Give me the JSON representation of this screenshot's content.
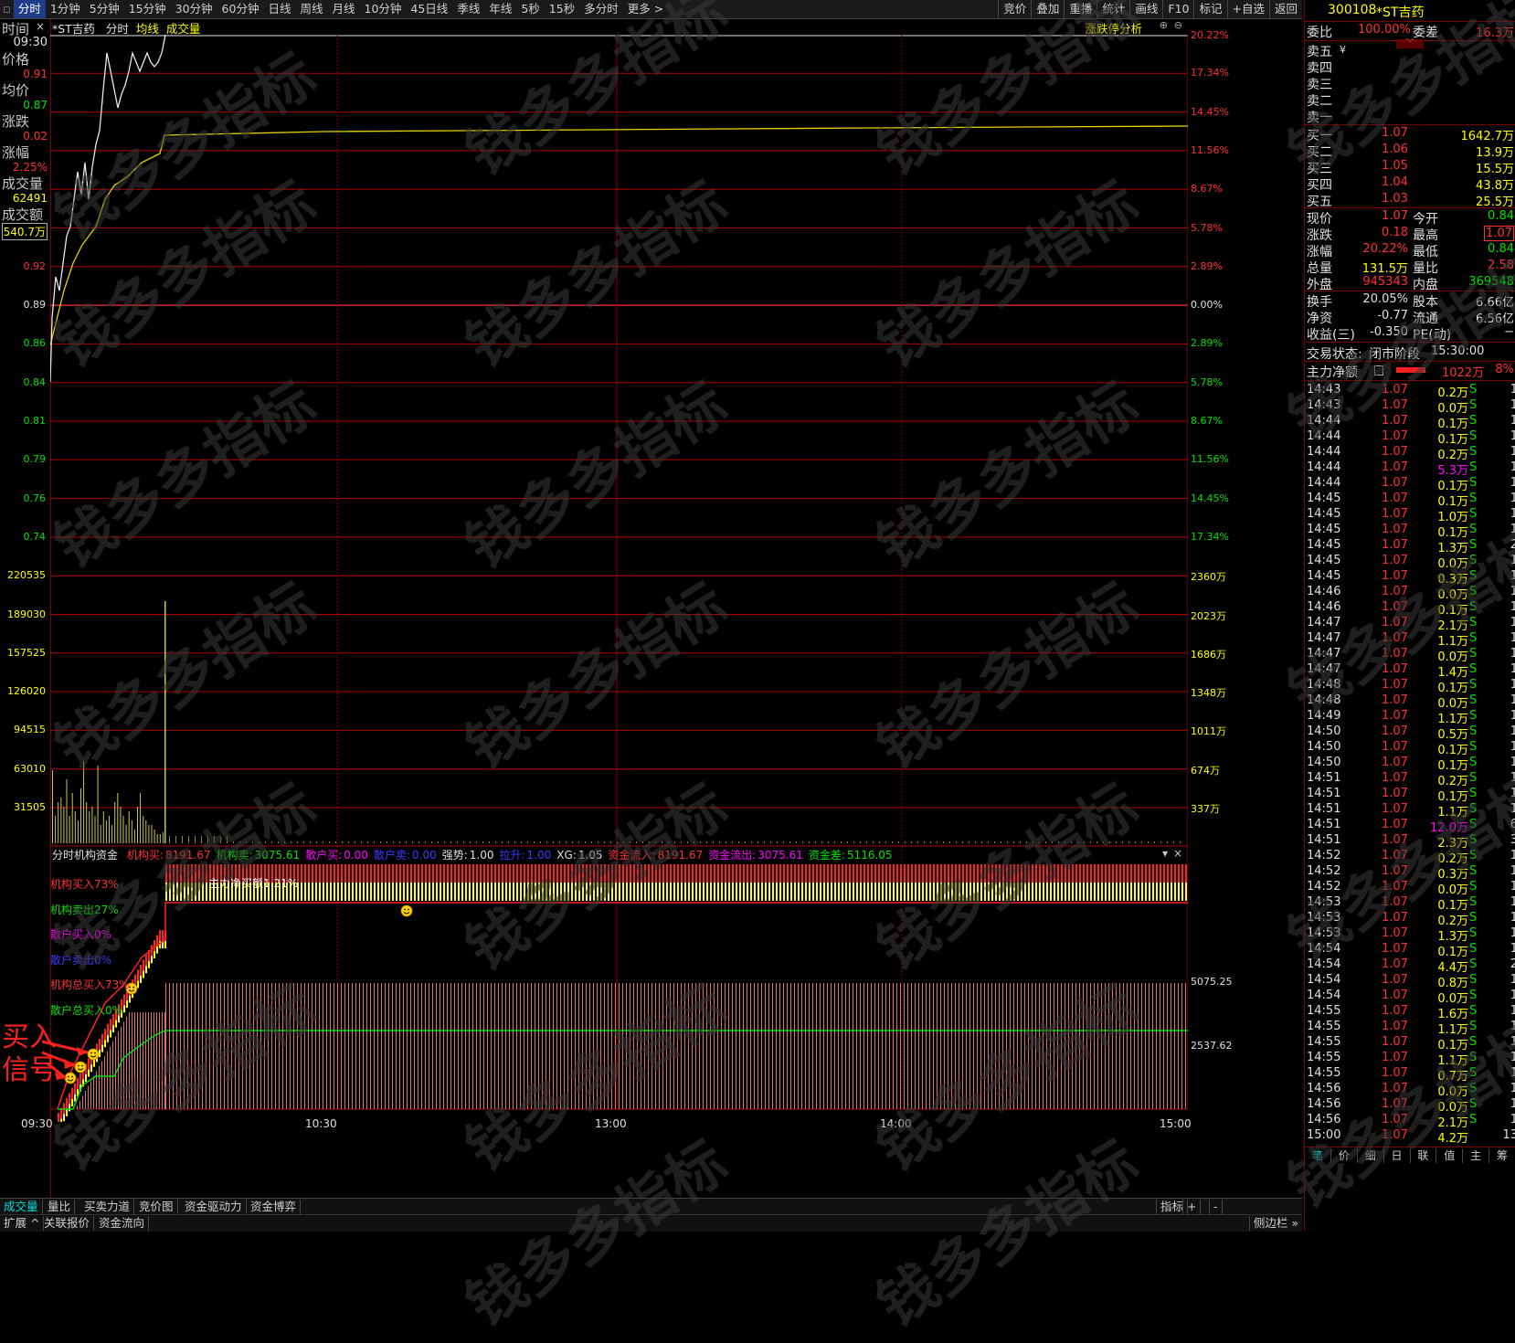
{
  "toolbar": {
    "tabs": [
      "分时",
      "1分钟",
      "5分钟",
      "15分钟",
      "30分钟",
      "60分钟",
      "日线",
      "周线",
      "月线",
      "10分钟",
      "45日线",
      "季线",
      "年线",
      "5秒",
      "15秒",
      "多分时",
      "更多 >"
    ],
    "right": [
      "竞价",
      "叠加",
      "重播",
      "统计",
      "画线",
      "F10",
      "标记",
      "+自选",
      "返回"
    ]
  },
  "chart_header": {
    "stock": "*ST吉药",
    "mode": "分时",
    "avg": "均线",
    "vol": "成交量",
    "analysis": "涨跌停分析"
  },
  "left_info": {
    "time_label": "时间",
    "time_value": "09:30",
    "price_label": "价格",
    "price_value": "0.91",
    "avg_label": "均价",
    "avg_value": "0.87",
    "change_label": "涨跌",
    "change_value": "0.02",
    "pct_label": "涨幅",
    "pct_value": "2.25%",
    "vol_label": "成交量",
    "vol_value": "62491",
    "amt_label": "成交额",
    "amt_value": "540.7万"
  },
  "price_axis_left": [
    "0.92",
    "0.89",
    "0.86",
    "0.84",
    "0.81",
    "0.79",
    "0.76",
    "0.74"
  ],
  "price_axis_right": [
    "20.22%",
    "17.34%",
    "14.45%",
    "11.56%",
    "8.67%",
    "5.78%",
    "2.89%",
    "0.00%",
    "2.89%",
    "5.78%",
    "8.67%",
    "11.56%",
    "14.45%",
    "17.34%"
  ],
  "volume_axis_left": [
    "220535",
    "189030",
    "157525",
    "126020",
    "94515",
    "63010",
    "31505"
  ],
  "volume_axis_right": [
    "2360万",
    "2023万",
    "1686万",
    "1348万",
    "1011万",
    "674万",
    "337万"
  ],
  "indicator": {
    "name": "分时机构资金",
    "items": [
      {
        "label": "机构买:",
        "value": "8191.67",
        "color": "#ff3030"
      },
      {
        "label": "机构卖:",
        "value": "3075.61",
        "color": "#00e000"
      },
      {
        "label": "散户买:",
        "value": "0.00",
        "color": "#ff00ff"
      },
      {
        "label": "散户卖:",
        "value": "0.00",
        "color": "#3a3aff"
      },
      {
        "label": "强势:",
        "value": "1.00",
        "color": "#e0e0e0"
      },
      {
        "label": "拉升:",
        "value": "1.00",
        "color": "#3a3aff"
      },
      {
        "label": "XG:",
        "value": "1.05",
        "color": "#e0e0e0"
      },
      {
        "label": "资金流入:",
        "value": "8191.67",
        "color": "#ff3030"
      },
      {
        "label": "资金流出:",
        "value": "3075.61",
        "color": "#ff00ff"
      },
      {
        "label": "资金差:",
        "value": "5116.05",
        "color": "#00e000"
      }
    ],
    "legend": [
      {
        "text": "机构买入73%",
        "color": "#ff3030"
      },
      {
        "text": "机构卖出27%",
        "color": "#00e000"
      },
      {
        "text": "散户买入0%",
        "color": "#ff00ff"
      },
      {
        "text": "散户卖出0%",
        "color": "#3a3aff"
      },
      {
        "text": "机构总买入73%",
        "color": "#ff3030"
      },
      {
        "text": "散户总买入0%",
        "color": "#00e000"
      }
    ],
    "banner": "主力净买额1.21%",
    "right_ticks": [
      "5075.25",
      "2537.62"
    ],
    "signal": "买入信号"
  },
  "time_axis": [
    "09:30",
    "10:30",
    "13:00",
    "14:00",
    "15:00"
  ],
  "bottom_tabs_1": [
    "成交量",
    "量比",
    "买卖力道",
    "竞价图",
    "资金驱动力",
    "资金博弈"
  ],
  "bottom_right_1": [
    "指标",
    "+",
    "-"
  ],
  "bottom_tabs_2": [
    "扩展 ^",
    "关联报价",
    "资金流向"
  ],
  "bottom_right_2": "侧边栏 »",
  "panel": {
    "code": "300108",
    "name": "*ST吉药",
    "weibi_label": "委比",
    "weibi": "100.00%",
    "weicha_label": "委差",
    "weicha": "16.3万",
    "asks": [
      "卖五",
      "卖四",
      "卖三",
      "卖二",
      "卖一"
    ],
    "ask_currency": "¥",
    "bids": [
      {
        "label": "买一",
        "price": "1.07",
        "vol": "1642.7万"
      },
      {
        "label": "买二",
        "price": "1.06",
        "vol": "13.9万"
      },
      {
        "label": "买三",
        "price": "1.05",
        "vol": "15.5万"
      },
      {
        "label": "买四",
        "price": "1.04",
        "vol": "43.8万"
      },
      {
        "label": "买五",
        "price": "1.03",
        "vol": "25.5万"
      }
    ],
    "stats": [
      {
        "l1": "现价",
        "v1": "1.07",
        "c1": "red",
        "l2": "今开",
        "v2": "0.84",
        "c2": "green"
      },
      {
        "l1": "涨跌",
        "v1": "0.18",
        "c1": "red",
        "l2": "最高",
        "v2": "1.07",
        "c2": "red"
      },
      {
        "l1": "涨幅",
        "v1": "20.22%",
        "c1": "red",
        "l2": "最低",
        "v2": "0.84",
        "c2": "green"
      },
      {
        "l1": "总量",
        "v1": "131.5万",
        "c1": "yellow",
        "l2": "量比",
        "v2": "2.58",
        "c2": "red"
      },
      {
        "l1": "外盘",
        "v1": "945343",
        "c1": "red",
        "l2": "内盘",
        "v2": "369548",
        "c2": "green"
      }
    ],
    "stats2": [
      {
        "l1": "换手",
        "v1": "20.05%",
        "l2": "股本",
        "v2": "6.66亿"
      },
      {
        "l1": "净资",
        "v1": "-0.77",
        "l2": "流通",
        "v2": "6.56亿"
      },
      {
        "l1": "收益(三)",
        "v1": "-0.350",
        "l2": "PE(动)",
        "v2": "−"
      }
    ],
    "trade_status_label": "交易状态:",
    "trade_status": "闭市阶段",
    "trade_time": "15:30:00",
    "main_net_label": "主力净额",
    "main_net": "1022万",
    "main_net_pct": "8%",
    "ticks": [
      [
        "14:43",
        "1.07",
        "0.2万",
        "S",
        "1"
      ],
      [
        "14:43",
        "1.07",
        "0.0万",
        "S",
        "1"
      ],
      [
        "14:44",
        "1.07",
        "0.1万",
        "S",
        "1"
      ],
      [
        "14:44",
        "1.07",
        "0.1万",
        "S",
        "1"
      ],
      [
        "14:44",
        "1.07",
        "0.2万",
        "S",
        "1"
      ],
      [
        "14:44",
        "1.07",
        "5.3万",
        "S",
        "1"
      ],
      [
        "14:44",
        "1.07",
        "0.1万",
        "S",
        "1"
      ],
      [
        "14:45",
        "1.07",
        "0.1万",
        "S",
        "1"
      ],
      [
        "14:45",
        "1.07",
        "1.0万",
        "S",
        "1"
      ],
      [
        "14:45",
        "1.07",
        "0.1万",
        "S",
        "1"
      ],
      [
        "14:45",
        "1.07",
        "1.3万",
        "S",
        "2"
      ],
      [
        "14:45",
        "1.07",
        "0.0万",
        "S",
        "1"
      ],
      [
        "14:45",
        "1.07",
        "0.3万",
        "S",
        "1"
      ],
      [
        "14:46",
        "1.07",
        "0.0万",
        "S",
        "1"
      ],
      [
        "14:46",
        "1.07",
        "0.1万",
        "S",
        "1"
      ],
      [
        "14:47",
        "1.07",
        "2.1万",
        "S",
        "1"
      ],
      [
        "14:47",
        "1.07",
        "1.1万",
        "S",
        "1"
      ],
      [
        "14:47",
        "1.07",
        "0.0万",
        "S",
        "1"
      ],
      [
        "14:47",
        "1.07",
        "1.4万",
        "S",
        "1"
      ],
      [
        "14:48",
        "1.07",
        "0.1万",
        "S",
        "1"
      ],
      [
        "14:48",
        "1.07",
        "0.0万",
        "S",
        "1"
      ],
      [
        "14:49",
        "1.07",
        "1.1万",
        "S",
        "1"
      ],
      [
        "14:50",
        "1.07",
        "0.5万",
        "S",
        "1"
      ],
      [
        "14:50",
        "1.07",
        "0.1万",
        "S",
        "1"
      ],
      [
        "14:50",
        "1.07",
        "0.1万",
        "S",
        "1"
      ],
      [
        "14:51",
        "1.07",
        "0.2万",
        "S",
        "1"
      ],
      [
        "14:51",
        "1.07",
        "0.1万",
        "S",
        "1"
      ],
      [
        "14:51",
        "1.07",
        "1.1万",
        "S",
        "1"
      ],
      [
        "14:51",
        "1.07",
        "12.0万",
        "S",
        "6"
      ],
      [
        "14:51",
        "1.07",
        "2.3万",
        "S",
        "3"
      ],
      [
        "14:52",
        "1.07",
        "0.2万",
        "S",
        "1"
      ],
      [
        "14:52",
        "1.07",
        "0.3万",
        "S",
        "1"
      ],
      [
        "14:52",
        "1.07",
        "0.0万",
        "S",
        "1"
      ],
      [
        "14:53",
        "1.07",
        "0.1万",
        "S",
        "1"
      ],
      [
        "14:53",
        "1.07",
        "0.2万",
        "S",
        "1"
      ],
      [
        "14:53",
        "1.07",
        "1.3万",
        "S",
        "1"
      ],
      [
        "14:54",
        "1.07",
        "0.1万",
        "S",
        "1"
      ],
      [
        "14:54",
        "1.07",
        "4.4万",
        "S",
        "2"
      ],
      [
        "14:54",
        "1.07",
        "0.8万",
        "S",
        "1"
      ],
      [
        "14:54",
        "1.07",
        "0.0万",
        "S",
        "1"
      ],
      [
        "14:55",
        "1.07",
        "1.6万",
        "S",
        "1"
      ],
      [
        "14:55",
        "1.07",
        "1.1万",
        "S",
        "1"
      ],
      [
        "14:55",
        "1.07",
        "0.1万",
        "S",
        "1"
      ],
      [
        "14:55",
        "1.07",
        "1.1万",
        "S",
        "1"
      ],
      [
        "14:55",
        "1.07",
        "0.7万",
        "S",
        "1"
      ],
      [
        "14:56",
        "1.07",
        "0.0万",
        "S",
        "1"
      ],
      [
        "14:56",
        "1.07",
        "0.0万",
        "S",
        "1"
      ],
      [
        "14:56",
        "1.07",
        "2.1万",
        "S",
        "1"
      ],
      [
        "15:00",
        "1.07",
        "4.2万",
        "",
        "13"
      ]
    ],
    "tabs": [
      "笔",
      "价",
      "细",
      "日",
      "联",
      "值",
      "主",
      "筹"
    ]
  },
  "watermark": "钱多多指标",
  "chart_data": {
    "type": "line",
    "title": "",
    "price_ylim": [
      0.72,
      1.07
    ],
    "x_range": [
      "09:30",
      "15:00"
    ]
  }
}
